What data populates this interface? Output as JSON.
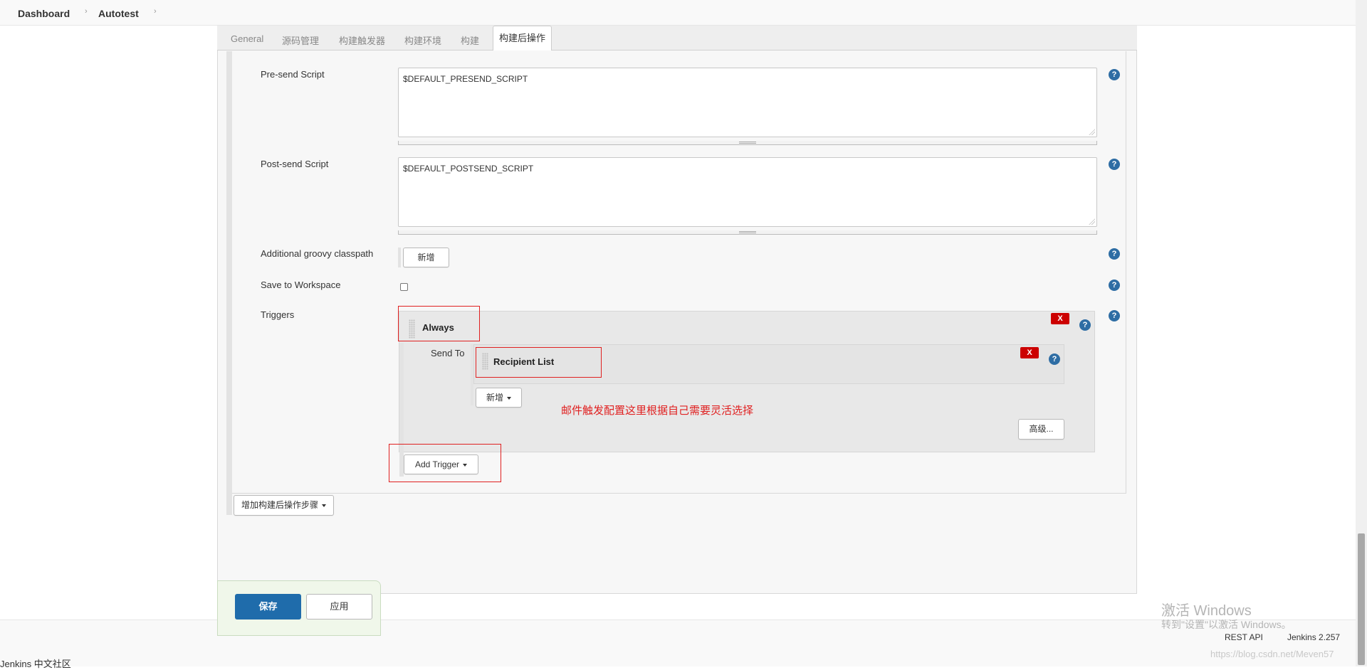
{
  "breadcrumb": {
    "items": [
      "Dashboard",
      "Autotest"
    ],
    "separator": "›"
  },
  "tabs": {
    "general": "General",
    "scm": "源码管理",
    "triggers": "构建触发器",
    "environment": "构建环境",
    "build": "构建",
    "post_build": "构建后操作"
  },
  "form": {
    "presend_label": "Pre-send Script",
    "presend_value": "$DEFAULT_PRESEND_SCRIPT",
    "postsend_label": "Post-send Script",
    "postsend_value": "$DEFAULT_POSTSEND_SCRIPT",
    "classpath_label": "Additional groovy classpath",
    "classpath_add_button": "新增",
    "workspace_label": "Save to Workspace",
    "workspace_checked": false,
    "triggers_label": "Triggers",
    "help_glyph": "?"
  },
  "trigger": {
    "name": "Always",
    "remove_glyph": "X",
    "send_to_label": "Send To",
    "recipient_name": "Recipient List",
    "recipient_remove_glyph": "X",
    "add_recipient_button": "新增",
    "advanced_button": "高级...",
    "add_trigger_button": "Add Trigger"
  },
  "annotation": {
    "text": "邮件触发配置这里根据自己需要灵活选择",
    "color": "#e02020"
  },
  "add_post_build_step_button": "增加构建后操作步骤",
  "actions": {
    "save": "保存",
    "apply": "应用"
  },
  "footer": {
    "community": "Jenkins 中文社区",
    "rest_api": "REST API",
    "version": "Jenkins 2.257"
  },
  "watermark": {
    "activate_title": "激活 Windows",
    "activate_sub": "转到\"设置\"以激活 Windows。",
    "url": "https://blog.csdn.net/Meven57"
  },
  "colors": {
    "primary": "#1f6cab",
    "danger": "#cc0000",
    "highlight": "#e02020"
  }
}
